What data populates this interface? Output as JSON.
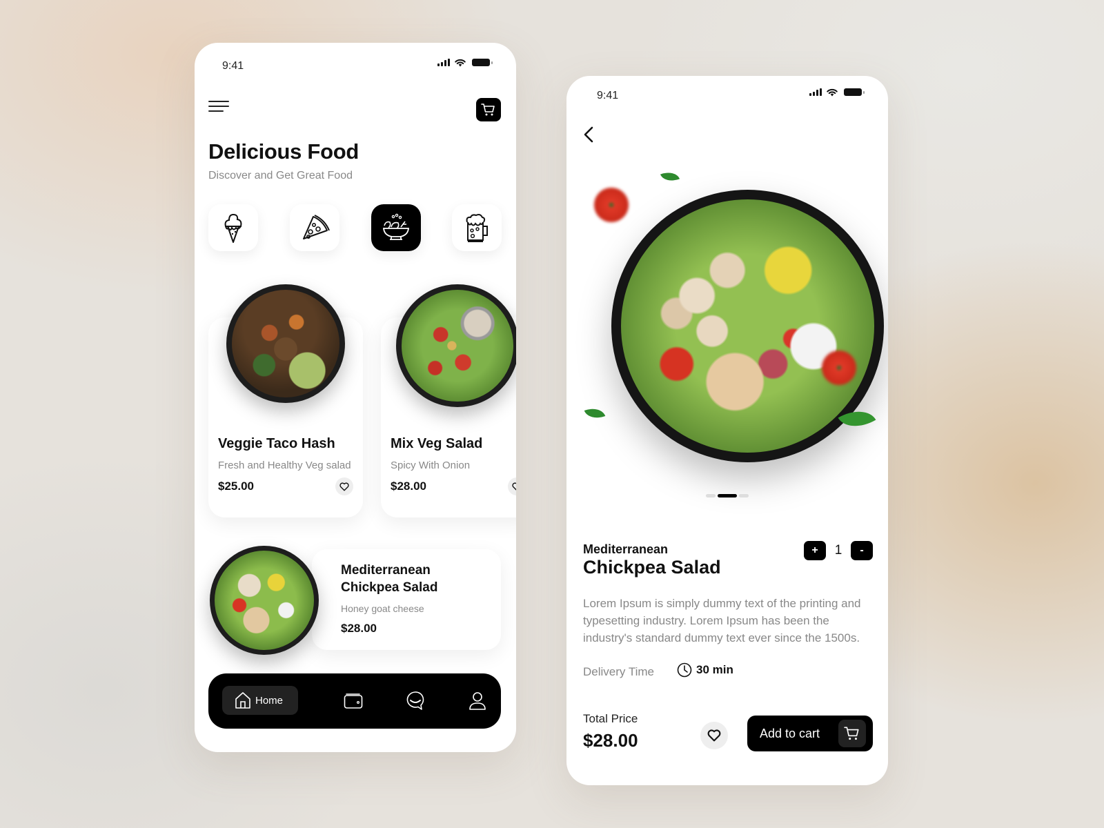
{
  "home_screen": {
    "status_bar": {
      "time": "9:41"
    },
    "header": {
      "menu_icon": "hamburger-menu-icon",
      "cart_icon": "shopping-cart-icon",
      "title": "Delicious Food",
      "subtitle": "Discover and Get Great Food"
    },
    "categories": [
      {
        "name": "Ice Cream",
        "icon": "ice-cream-icon",
        "active": false
      },
      {
        "name": "Pizza",
        "icon": "pizza-slice-icon",
        "active": false
      },
      {
        "name": "Salad",
        "icon": "salad-bowl-icon",
        "active": true
      },
      {
        "name": "Beer",
        "icon": "beer-mug-icon",
        "active": false
      }
    ],
    "featured": [
      {
        "name": "Veggie Taco Hash",
        "description": "Fresh and Healthy Veg salad",
        "price": "$25.00"
      },
      {
        "name": "Mix Veg Salad",
        "description": "Spicy With Onion",
        "price": "$28.00"
      }
    ],
    "list_item": {
      "name_line1": "Mediterranean",
      "name_line2": "Chickpea Salad",
      "description": "Honey goat cheese",
      "price": "$28.00"
    },
    "bottom_nav": {
      "items": [
        {
          "label": "Home",
          "icon": "home-icon",
          "active": true
        },
        {
          "label": "",
          "icon": "wallet-icon",
          "active": false
        },
        {
          "label": "",
          "icon": "chat-icon",
          "active": false
        },
        {
          "label": "",
          "icon": "user-icon",
          "active": false
        }
      ]
    }
  },
  "detail_screen": {
    "status_bar": {
      "time": "9:41"
    },
    "back_icon": "chevron-left-icon",
    "carousel": {
      "count": 3,
      "active_index": 1
    },
    "product": {
      "subtitle": "Mediterranean",
      "title": "Chickpea Salad",
      "quantity": "1",
      "increment_label": "+",
      "decrement_label": "-",
      "description": "Lorem Ipsum is simply dummy text of the printing and typesetting industry. Lorem Ipsum has been the industry's standard dummy text ever since the 1500s.",
      "delivery_label": "Delivery Time",
      "delivery_value": "30 min"
    },
    "footer": {
      "total_label": "Total Price",
      "total_value": "$28.00",
      "add_to_cart_label": "Add to cart"
    }
  },
  "colors": {
    "primary": "#000000",
    "muted_text": "#888888",
    "chip_bg": "#eeeeee"
  }
}
